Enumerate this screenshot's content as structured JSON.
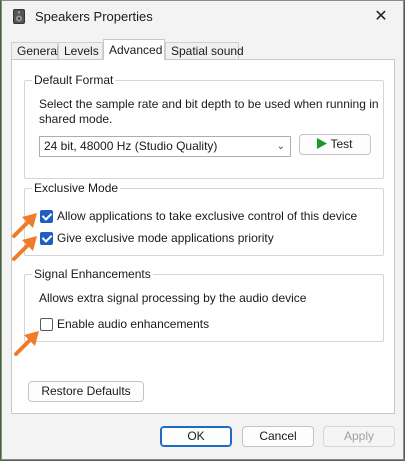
{
  "window": {
    "title": "Speakers Properties",
    "close_glyph": "✕"
  },
  "tabs": [
    {
      "label": "General",
      "active": false
    },
    {
      "label": "Levels",
      "active": false
    },
    {
      "label": "Advanced",
      "active": true
    },
    {
      "label": "Spatial sound",
      "active": false
    }
  ],
  "default_format": {
    "group_label": "Default Format",
    "description": "Select the sample rate and bit depth to be used when running in shared mode.",
    "selected_format": "24 bit, 48000 Hz (Studio Quality)",
    "test_label": "Test",
    "test_icon": "play-icon"
  },
  "exclusive_mode": {
    "group_label": "Exclusive Mode",
    "options": [
      {
        "label": "Allow applications to take exclusive control of this device",
        "checked": true
      },
      {
        "label": "Give exclusive mode applications priority",
        "checked": true
      }
    ]
  },
  "signal_enhancements": {
    "group_label": "Signal Enhancements",
    "description": "Allows extra signal processing by the audio device",
    "option": {
      "label": "Enable audio enhancements",
      "checked": false
    }
  },
  "restore_defaults_label": "Restore Defaults",
  "footer": {
    "ok": "OK",
    "cancel": "Cancel",
    "apply": "Apply"
  },
  "colors": {
    "accent": "#1e5fc1",
    "annotation_arrow": "#f07c2a",
    "test_play": "#1a9a2a"
  }
}
